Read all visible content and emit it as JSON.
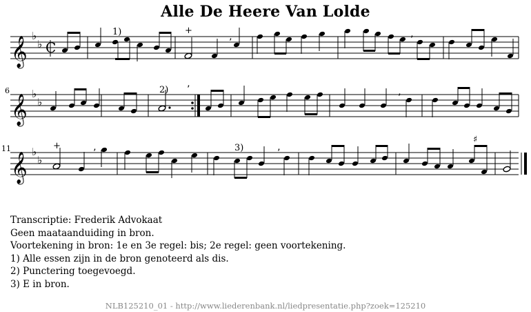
{
  "title": "Alle De Heere Van Lolde",
  "score": {
    "clef": "treble",
    "key_signature": "B-flat major (2 flats)",
    "time_signature": "alla breve",
    "systems": [
      {
        "measure_number": "",
        "annotations": [
          "1)",
          "+"
        ]
      },
      {
        "measure_number": "6",
        "annotations": [
          "2)"
        ]
      },
      {
        "measure_number": "11",
        "annotations": [
          "+",
          "3)",
          "♯"
        ]
      }
    ]
  },
  "notes": [
    "Transcriptie: Frederik Advokaat",
    "Geen maataanduiding in bron.",
    "Voortekening in bron: 1e en 3e regel: bis; 2e regel: geen voortekening.",
    "1) Alle essen zijn in de bron genoteerd als dis.",
    "2) Punctering toegevoegd.",
    "3) E in bron."
  ],
  "footer": "NLB125210_01 - http://www.liederenbank.nl/liedpresentatie.php?zoek=125210"
}
